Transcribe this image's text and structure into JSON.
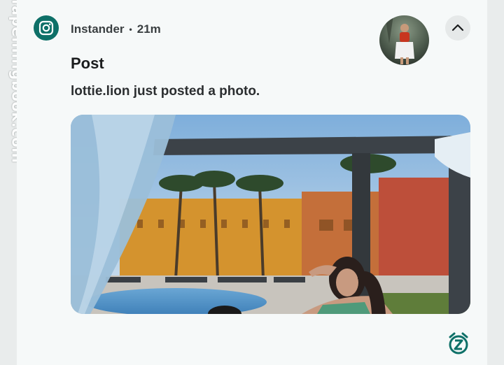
{
  "watermark": {
    "text": "fapenlingbook.com"
  },
  "notification": {
    "app_name": "Instander",
    "separator": "•",
    "time": "21m",
    "title": "Post",
    "message": "lottie.lion just posted a photo."
  },
  "icons": {
    "app": "instagram-icon",
    "collapse": "chevron-up-icon",
    "snooze": "snooze-icon"
  },
  "colors": {
    "accent": "#0e7068",
    "background": "#f6f9f9",
    "text": "#2b2e30"
  }
}
